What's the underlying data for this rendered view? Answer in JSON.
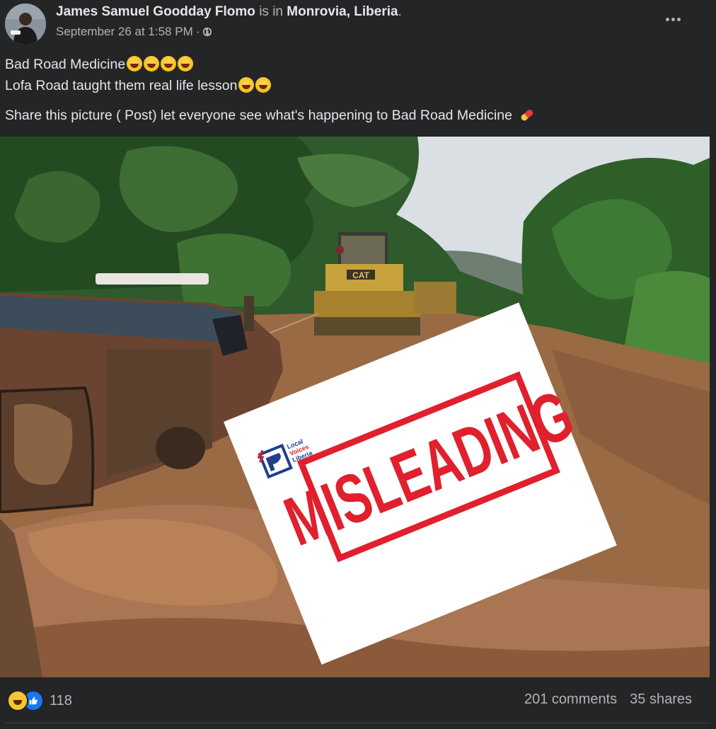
{
  "post": {
    "author": "James Samuel Goodday Flomo",
    "is_in": "is in",
    "location": "Monrovia, Liberia",
    "location_suffix": ".",
    "timestamp": "September 26 at 1:58 PM",
    "separator": "·",
    "privacy_icon": "globe-icon",
    "more_icon": "more-dots-icon",
    "lines": [
      "Bad Road Medicine",
      "Lofa Road taught them real life lesson",
      "Share this picture ( Post)  let everyone see what's happening to Bad Road Medicine"
    ],
    "line_emojis": [
      "joy-emoji",
      "joy-emoji",
      "pill-emoji"
    ]
  },
  "photo": {
    "stamp_text": "MISLEADING",
    "logo_lines": [
      "Local",
      "Voices",
      "Liberia"
    ],
    "bulldozer_label": "CAT",
    "colors": {
      "stamp_red": "#e0202d",
      "logo_blue": "#1f3f8f"
    }
  },
  "footer": {
    "reaction_icons": [
      "haha-reaction-icon",
      "like-reaction-icon"
    ],
    "reaction_count": "118",
    "comments": "201 comments",
    "shares": "35 shares"
  },
  "colors": {
    "background": "#242526",
    "text": "#e4e6eb",
    "muted": "#b0b3b8",
    "like_blue": "#1877f2"
  }
}
